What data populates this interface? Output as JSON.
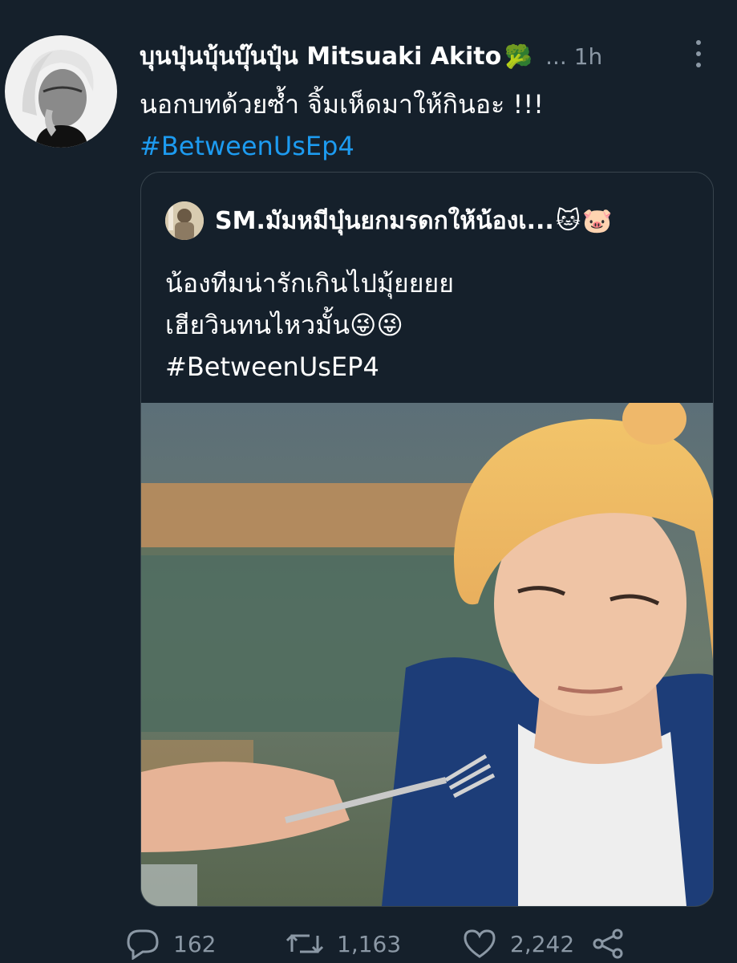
{
  "tweet": {
    "author_name": "บุนปุ่นบุ้นบุ๊นปุ๋น Mitsuaki Akito",
    "author_emoji": "🥦",
    "meta": "... 1h",
    "text_line1": "นอกบทด้วยซ้ำ จิ้มเห็ดมาให้กินอะ !!!",
    "hashtag": "#BetweenUsEp4"
  },
  "quote": {
    "author_name": "SM.มัมหมีบุ๋นยกมรดกให้น้องเ...",
    "emojis": [
      "🐱",
      "🐷"
    ],
    "line1": "น้องทีมน่ารักเกินไปมุ้ยยยย",
    "line2": "เฮียวินทนไหวมั้น😜😜",
    "hashtag": "#BetweenUsEP4"
  },
  "actions": {
    "reply_count": "162",
    "retweet_count": "1,163",
    "like_count": "2,242"
  },
  "icons": {
    "reply": "reply-icon",
    "retweet": "retweet-icon",
    "like": "like-icon",
    "share": "share-icon",
    "more": "more-options-icon"
  },
  "colors": {
    "background": "#15202b",
    "accent": "#1d9bf0",
    "muted": "#8b98a5",
    "border": "#38444d"
  }
}
